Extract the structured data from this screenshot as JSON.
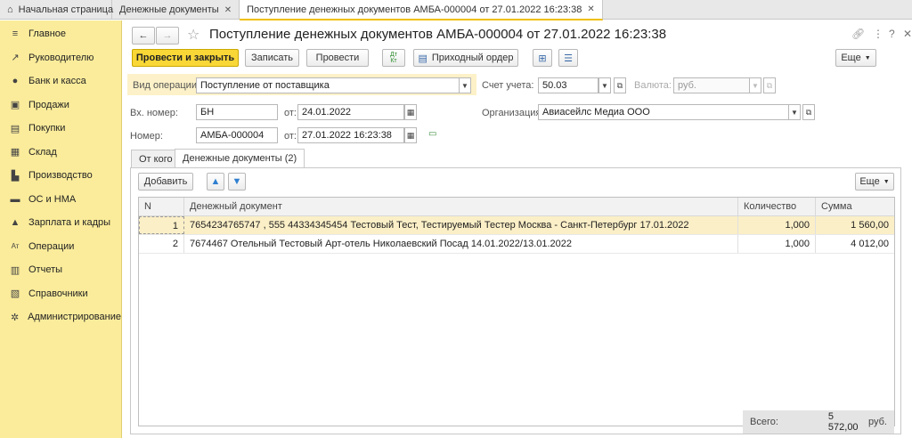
{
  "tabs": {
    "home": "Начальная страница",
    "tab1": "Денежные документы",
    "tab2": "Поступление денежных документов АМБА-000004 от 27.01.2022 16:23:38"
  },
  "sidebar": {
    "items": [
      {
        "label": "Главное",
        "icon": "≡"
      },
      {
        "label": "Руководителю",
        "icon": "↗"
      },
      {
        "label": "Банк и касса",
        "icon": "●"
      },
      {
        "label": "Продажи",
        "icon": "▣"
      },
      {
        "label": "Покупки",
        "icon": "▤"
      },
      {
        "label": "Склад",
        "icon": "▦"
      },
      {
        "label": "Производство",
        "icon": "▙"
      },
      {
        "label": "ОС и НМА",
        "icon": "▬"
      },
      {
        "label": "Зарплата и кадры",
        "icon": "▲"
      },
      {
        "label": "Операции",
        "icon": "Ат"
      },
      {
        "label": "Отчеты",
        "icon": "▥"
      },
      {
        "label": "Справочники",
        "icon": "▧"
      },
      {
        "label": "Администрирование",
        "icon": "✲"
      }
    ]
  },
  "header": {
    "title": "Поступление денежных документов АМБА-000004 от 27.01.2022 16:23:38"
  },
  "toolbar": {
    "post_close": "Провести и закрыть",
    "save": "Записать",
    "post": "Провести",
    "dtkt": "Дт Кт",
    "receipt_order": "Приходный ордер",
    "more": "Еще"
  },
  "form": {
    "op_type_label": "Вид операции:",
    "op_type_value": "Поступление от поставщика",
    "in_number_label": "Вх. номер:",
    "in_number_value": "БН",
    "from_label": "от:",
    "in_date_value": "24.01.2022",
    "number_label": "Номер:",
    "number_value": "АМБА-000004",
    "date_value": "27.01.2022 16:23:38",
    "account_label": "Счет учета:",
    "account_value": "50.03",
    "currency_label": "Валюта:",
    "currency_value": "руб.",
    "org_label": "Организация:",
    "org_value": "Авиасейлс Медиа ООО"
  },
  "form_tabs": {
    "from_whom": "От кого",
    "docs": "Денежные документы (2)"
  },
  "table_toolbar": {
    "add": "Добавить",
    "more": "Еще"
  },
  "table": {
    "headers": [
      "N",
      "Денежный документ",
      "Количество",
      "Сумма"
    ],
    "rows": [
      {
        "n": "1",
        "doc": "7654234765747 , 555 44334345454 Тестовый Тест, Тестируемый Тестер Москва - Санкт-Петербург 17.01.2022",
        "qty": "1,000",
        "sum": "1 560,00"
      },
      {
        "n": "2",
        "doc": "7674467 Отельный Тестовый Арт-отель Николаевский Посад 14.01.2022/13.01.2022",
        "qty": "1,000",
        "sum": "4 012,00"
      }
    ]
  },
  "footer": {
    "total_label": "Всего:",
    "total_value": "5 572,00",
    "currency": "руб."
  }
}
